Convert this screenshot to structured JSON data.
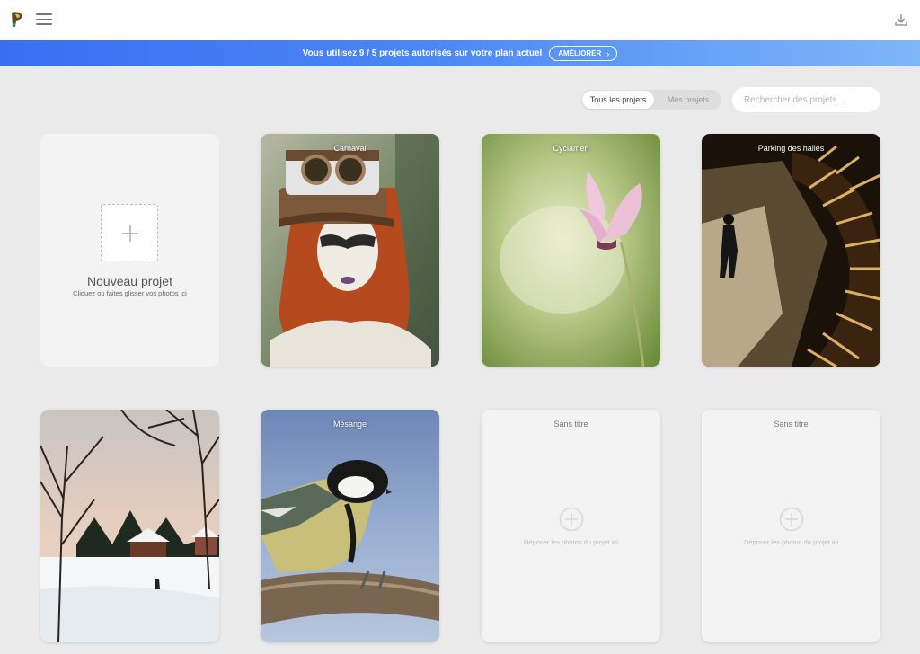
{
  "header": {
    "logo_icon": "brush-logo-icon",
    "menu_icon": "hamburger-menu-icon",
    "download_icon": "download-icon"
  },
  "banner": {
    "text": "Vous utilisez 9 / 5 projets autorisés sur votre plan actuel",
    "upgrade_label": "AMÉLIORER"
  },
  "filters": {
    "all_label": "Tous les projets",
    "mine_label": "Mes projets",
    "search_placeholder": "Rechercher des projets..."
  },
  "new_project": {
    "title": "Nouveau projet",
    "subtitle": "Cliquez ou faites glisser vos photos ici"
  },
  "projects": [
    {
      "title": "Carnaval"
    },
    {
      "title": "Cyclamen"
    },
    {
      "title": "Parking des halles"
    },
    {
      "title": ""
    },
    {
      "title": "Mésange"
    },
    {
      "title": "Sans titre",
      "drop_text": "Déposer les photos du projet ici"
    },
    {
      "title": "Sans titre",
      "drop_text": "Déposer les photos du projet ici"
    }
  ],
  "colors": {
    "banner_start": "#3a6ef2",
    "banner_end": "#7fb6f8",
    "background": "#eaeaea"
  }
}
